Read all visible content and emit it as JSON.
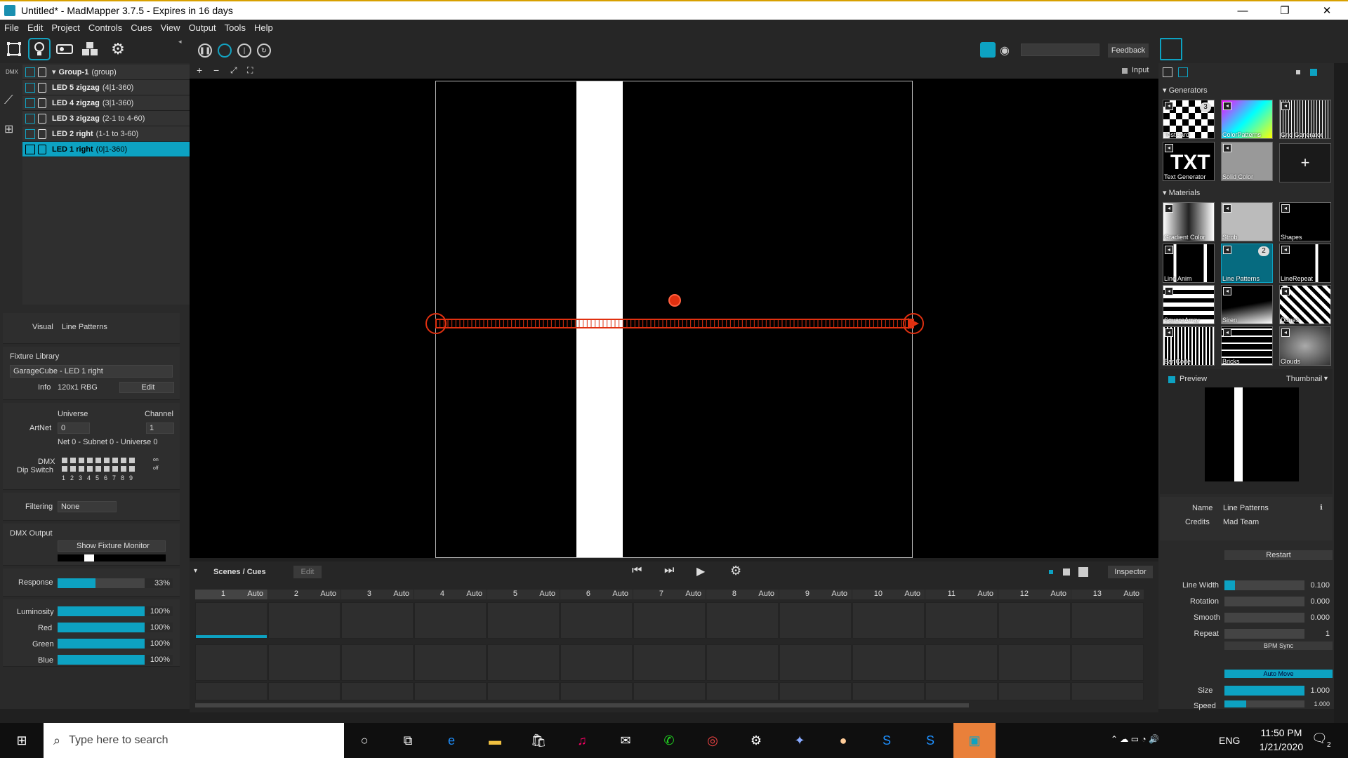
{
  "window": {
    "title": "Untitled* - MadMapper 3.7.5 - Expires in 16 days",
    "minimize": "—",
    "maximize": "❐",
    "close": "✕"
  },
  "menu": [
    "File",
    "Edit",
    "Project",
    "Controls",
    "Cues",
    "View",
    "Output",
    "Tools",
    "Help"
  ],
  "toolbar": {
    "feedback_label": "Feedback"
  },
  "layers": {
    "group": {
      "name": "Group-1",
      "suffix": "(group)"
    },
    "items": [
      {
        "name": "LED 5 zigzag",
        "suffix": "(4|1-360)"
      },
      {
        "name": "LED 4 zigzag",
        "suffix": "(3|1-360)"
      },
      {
        "name": "LED 3 zigzag",
        "suffix": "(2-1 to 4-60)"
      },
      {
        "name": "LED 2 right",
        "suffix": "(1-1 to 3-60)"
      },
      {
        "name": "LED 1 right",
        "suffix": "(0|1-360)"
      }
    ],
    "side_label": "DMX"
  },
  "left_props": {
    "visual_label": "Visual",
    "visual_value": "Line Patterns",
    "fixture_library_label": "Fixture Library",
    "fixture_value": "GarageCube - LED 1 right",
    "info_label": "Info",
    "info_value": "120x1 RBG",
    "edit_label": "Edit",
    "universe_label": "Universe",
    "channel_label": "Channel",
    "artnet_label": "ArtNet",
    "artnet_universe": "0",
    "artnet_channel": "1",
    "net_text": "Net 0 - Subnet 0 - Universe 0",
    "dmx_label": "DMX",
    "dipswitch_label": "Dip Switch",
    "dip_numbers": [
      "1",
      "2",
      "3",
      "4",
      "5",
      "6",
      "7",
      "8",
      "9"
    ],
    "on_label": "on",
    "off_label": "off",
    "filtering_label": "Filtering",
    "filtering_value": "None",
    "dmx_output_label": "DMX Output",
    "show_fixture_monitor": "Show Fixture Monitor",
    "response_label": "Response",
    "response_value": "33%",
    "response_fraction": 0.33,
    "color_sliders": [
      {
        "label": "Luminosity",
        "value": "100%"
      },
      {
        "label": "Red",
        "value": "100%"
      },
      {
        "label": "Green",
        "value": "100%"
      },
      {
        "label": "Blue",
        "value": "100%"
      }
    ]
  },
  "canvas": {
    "input_label": "Input",
    "zoom_tools": [
      "+",
      "−",
      "⤢",
      "⛶"
    ]
  },
  "cues": {
    "title": "Scenes / Cues",
    "edit_label": "Edit",
    "inspector_label": "Inspector",
    "columns": [
      {
        "n": "1",
        "a": "Auto"
      },
      {
        "n": "2",
        "a": "Auto"
      },
      {
        "n": "3",
        "a": "Auto"
      },
      {
        "n": "4",
        "a": "Auto"
      },
      {
        "n": "5",
        "a": "Auto"
      },
      {
        "n": "6",
        "a": "Auto"
      },
      {
        "n": "7",
        "a": "Auto"
      },
      {
        "n": "8",
        "a": "Auto"
      },
      {
        "n": "9",
        "a": "Auto"
      },
      {
        "n": "10",
        "a": "Auto"
      },
      {
        "n": "11",
        "a": "Auto"
      },
      {
        "n": "12",
        "a": "Auto"
      },
      {
        "n": "13",
        "a": "Auto"
      }
    ]
  },
  "right": {
    "generators_label": "Generators",
    "generators": [
      {
        "name": "TestCard",
        "badge": "3"
      },
      {
        "name": "ColorPatterns"
      },
      {
        "name": "Grid Generator"
      },
      {
        "name": "Text Generator"
      },
      {
        "name": "Solid Color"
      }
    ],
    "add_label": "+",
    "materials_label": "Materials",
    "materials": [
      {
        "name": "Gradient Color"
      },
      {
        "name": "Strob"
      },
      {
        "name": "Shapes"
      },
      {
        "name": "Line Anim"
      },
      {
        "name": "Line Patterns",
        "badge": "2"
      },
      {
        "name": "LineRepeat"
      },
      {
        "name": "SquareArray"
      },
      {
        "name": "Siren"
      },
      {
        "name": "Dunes"
      },
      {
        "name": "Bar Code"
      },
      {
        "name": "Bricks"
      },
      {
        "name": "Clouds"
      }
    ],
    "preview_label": "Preview",
    "preview_mode": "Thumbnail",
    "name_label": "Name",
    "name_value": "Line Patterns",
    "credits_label": "Credits",
    "credits_value": "Mad Team",
    "restart_label": "Restart",
    "params": [
      {
        "label": "Line Width",
        "value": "0.100",
        "fraction": 0.1
      },
      {
        "label": "Rotation",
        "value": "0.000",
        "fraction": 0
      },
      {
        "label": "Smooth",
        "value": "0.000",
        "fraction": 0
      },
      {
        "label": "Repeat",
        "value": "1",
        "fraction": 0
      }
    ],
    "bpm_sync_label": "BPM Sync",
    "auto_move_label": "Auto Move",
    "size_label": "Size",
    "size_value": "1.000",
    "speed_label": "Speed",
    "speed_value": "1.000"
  },
  "taskbar": {
    "search_placeholder": "Type here to search",
    "lang": "ENG",
    "time": "11:50 PM",
    "date": "1/21/2020",
    "notif_count": "2"
  },
  "colors": {
    "accent": "#0da2c2",
    "fixture_line": "#e03010"
  }
}
